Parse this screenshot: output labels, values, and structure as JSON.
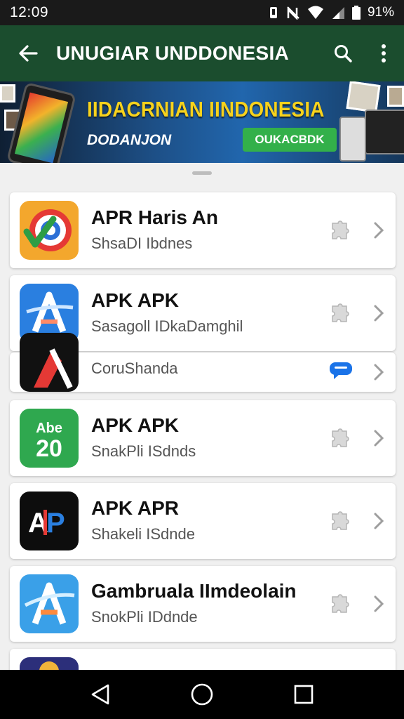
{
  "status_bar": {
    "time": "12:09",
    "battery": "91%"
  },
  "app_bar": {
    "title": "UNUGIAR UNDDONESIA",
    "icons": [
      "back-arrow-icon",
      "search-icon",
      "more-vert-icon"
    ]
  },
  "banner": {
    "headline": "IIDACRNIAN IINDONESIA",
    "subline": "DODANJON",
    "cta_label": "OUKACBDK"
  },
  "apps": [
    {
      "name": "APR Haris An",
      "subtitle": "ShsaDI Ibdnes",
      "icon": "colorful-ring-icon",
      "badge": "puzzle-icon"
    },
    {
      "name": "APK APK",
      "subtitle": "Sasagoll IDkaDamghil",
      "icon": "blue-a-icon",
      "badge": "puzzle-icon"
    },
    {
      "name": "",
      "subtitle": "CoruShanda",
      "icon": "red-a-icon",
      "badge": "chat-bubble-icon"
    },
    {
      "name": "APK APK",
      "subtitle": "SnakPli ISdnds",
      "icon": "green-abc-icon",
      "badge": "puzzle-icon"
    },
    {
      "name": "APK APR",
      "subtitle": "Shakeli ISdnde",
      "icon": "black-ap-icon",
      "badge": "puzzle-icon"
    },
    {
      "name": "Gambruala IImdeolain",
      "subtitle": "SnokPli IDdnde",
      "icon": "light-blue-a-icon",
      "badge": "puzzle-icon"
    }
  ],
  "colors": {
    "app_bar": "#1b4d2e",
    "headline": "#f7d21c",
    "cta": "#33b04a",
    "chat_badge": "#1a73e8"
  }
}
